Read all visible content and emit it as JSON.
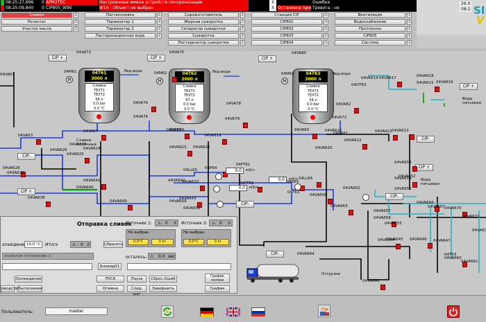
{
  "alarms": [
    {
      "time": "08:25:27,696",
      "code": "0",
      "source": "APROTEC",
      "message": "Настроенные имена устройств синхронизации",
      "flag": "X",
      "type": "Ошибка"
    },
    {
      "time": "08:25:09,840",
      "code": "0",
      "source": "CIP805_W90",
      "message": "W16 - Объект не выбран",
      "flag": "X",
      "type": "Остановка программы",
      "extra": "Тревога - не"
    }
  ],
  "brand": {
    "date": "26.0",
    "time": "08:2",
    "logo": "SIE",
    "logo2": "V"
  },
  "nav": [
    [
      "Сливки",
      "Пастеколовка",
      "Сыроизготовитель",
      "Станции CIP",
      "Вентиляция"
    ],
    [
      "Ретентат",
      "Термизатор 1",
      "Жирная сыворотка",
      "CIP801",
      "Водоснабжение"
    ],
    [
      "Участок масла",
      "Термизатор 2",
      "Сепаратор сыворотки",
      "CIP802",
      "Протоколы"
    ],
    [
      "",
      "Пастеризационная вода",
      "Сыворотка",
      "CIP803",
      "CIP805"
    ],
    [
      "",
      "",
      "Пастеризатор сыворотки",
      "CIP804",
      "Система"
    ]
  ],
  "tanks": [
    {
      "id": "04T61",
      "volume": "3000 л",
      "product": "Сливки",
      "text1": "TEXT1",
      "text2": "TEXT2",
      "level": "66  л",
      "pressure": "0.0  bar",
      "temp": "0.0 °C"
    },
    {
      "id": "04T62",
      "volume": "2000 л",
      "product": "Сливки",
      "text1": "TEXT1",
      "text2": "TEXT2",
      "level": "67  л",
      "pressure": "0.0  bar",
      "temp": "0.0 °C"
    },
    {
      "id": "04T63",
      "volume": "3000 л",
      "product": "Сливки",
      "text1": "TEXT1",
      "text2": "TEXT2",
      "level": "58  л",
      "pressure": "0.0  bar",
      "temp": "0.0 °C"
    }
  ],
  "labels": {
    "cip_plus": "CIP +",
    "cip_minus": "CIP-",
    "ice_water": "Лед.вода",
    "drink_water": "Вода питьевая",
    "cream_milk": "Сливки молочные",
    "tags": [
      "04VA72",
      "04VA75",
      "04VA80",
      "04M61",
      "04M62",
      "04M63",
      "04VA74",
      "04VA78",
      "04VA82",
      "04VA76",
      "04VA79",
      "04VA73",
      "04VA67",
      "04VA68",
      "04VA69",
      "04VA61",
      "04VA77",
      "04VA81",
      "04VA63",
      "04VA626",
      "04VA625",
      "04VA624",
      "04VA623",
      "04VA622",
      "04VA619",
      "04VA620",
      "04VA621",
      "04VA618",
      "04VA617",
      "04VA614",
      "04VA615",
      "04VA616",
      "04VA613",
      "04VA611",
      "04VA612",
      "04VA639",
      "04VA628",
      "04VA629",
      "04VA641",
      "04VA642",
      "04VA632",
      "04LL65",
      "04P64",
      "04FT61",
      "04VA638",
      "04VA640",
      "04VA649",
      "04VA659",
      "04VA643",
      "04P63",
      "04FT62",
      "04VA651",
      "04VA656",
      "04VA662",
      "04VA663",
      "04VA657",
      "04VA658",
      "04VA633",
      "04VA644",
      "04VA645",
      "04VA646",
      "04VA647",
      "04VA648",
      "04VA664",
      "04VA665",
      "04T63",
      "04VA666",
      "04VA667",
      "04VA670",
      "04VA671",
      "04VA654",
      "04VA655",
      "04VA653",
      "04VA652",
      "04VA660",
      "04VA661",
      "04VA630",
      "04VA601",
      "04LL64",
      "04DT63"
    ],
    "flow1": "0,0",
    "flow1_unit": "м3/ч",
    "flow2": "0,0",
    "flow2_unit": "м3/ч",
    "flow3": "0,0",
    "flow3_unit": "м3/ч",
    "otgruzka": "Отгрузка"
  },
  "dialog": {
    "title": "Отправка сливок",
    "source1": "Источник 1:",
    "source2": "Источник 2:",
    "zero1": "0",
    "unit_l": "л",
    "zero2": "0",
    "not_selected1": "Не выбран",
    "not_selected2": "Не выбран",
    "temp1": "0,0°",
    "temp1_unit": "C",
    "kg1": "0 кг",
    "temp2": "0,0°",
    "temp2_unit": "C",
    "kg2": "0 кг",
    "cooling_label": "хлаждения:",
    "cooling_val": "10,0",
    "cooling_unit": "°C",
    "total_label": "Итого",
    "total_val": "0",
    "total_unit": "л",
    "reset": "Сбросить",
    "remain_label": "осталось:",
    "remain_val": "0.0",
    "remain_unit": "sec",
    "start_pos": "ачальное положение",
    "block": "Блокир01",
    "btn_cool": "Охлаждение",
    "btn_start": "ПУСК",
    "btn_pause": "Пауза",
    "btn_reset_err": "Сброс.Ошиб",
    "btn_chart_flow": "График потоки",
    "btn_prod": "оводство",
    "btn_push": "Вытеснение",
    "btn_cancel": "Отмена",
    "btn_next": "След. шаг",
    "btn_finish": "Завершить",
    "btn_chart": "График"
  },
  "bottom": {
    "user_label": "Пользователь:",
    "user": "master"
  },
  "colors": {
    "pipe_blue": "#1d3bd8",
    "pipe_black": "#000000",
    "pipe_cyan": "#2ab0c8",
    "pipe_green": "#00a000",
    "valve_red": "#e01010",
    "accent": "#e04040"
  }
}
